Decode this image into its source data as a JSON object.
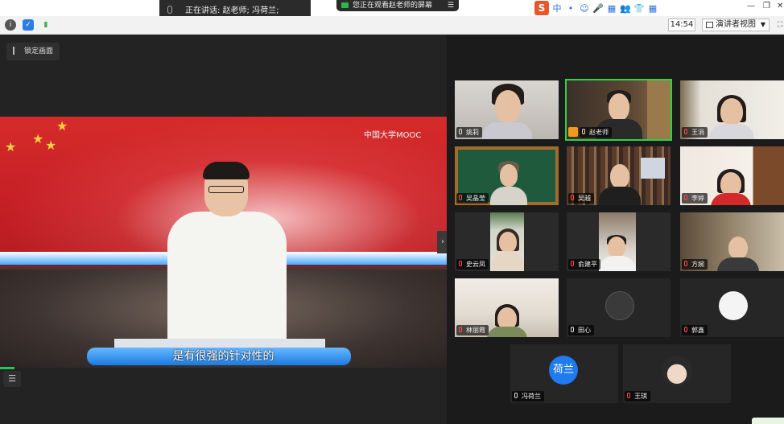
{
  "top": {
    "speaking_label": "正在讲话: 赵老师; 冯荷兰;",
    "watching_label": "您正在观看赵老师的屏幕",
    "time": "14:54",
    "view_mode": "演讲者视图",
    "ime_chars": [
      "中",
      "•",
      "☺",
      "🎤",
      "▦",
      "👥",
      "👕",
      "▦"
    ]
  },
  "main": {
    "lock_label": "锁定画面",
    "logo_text": "中国大学MOOC",
    "subtitle": "是有很强的针对性的"
  },
  "participants": [
    {
      "name": "姚莉",
      "scene": "light-room"
    },
    {
      "name": "赵老师",
      "scene": "bookshelf",
      "active": true,
      "host": true
    },
    {
      "name": "王涓",
      "scene": "bright-wall"
    },
    {
      "name": "吴晶莹",
      "scene": "chalkboard"
    },
    {
      "name": "吴越",
      "scene": "library"
    },
    {
      "name": "李婷",
      "scene": "home-door"
    },
    {
      "name": "史云凤",
      "scene": "window-plant"
    },
    {
      "name": "俞建平",
      "scene": "office"
    },
    {
      "name": "方婉",
      "scene": "study"
    },
    {
      "name": "林丽霞",
      "scene": "ceiling"
    },
    {
      "name": "田心",
      "scene": "avatar-dark"
    },
    {
      "name": "郭鑫",
      "scene": "avatar-light"
    },
    {
      "name": "冯荷兰",
      "scene": "avatar-text",
      "avatar_text": "荷兰"
    },
    {
      "name": "王琪",
      "scene": "avatar-cartoon"
    }
  ],
  "colors": {
    "active_border": "#2fd14a",
    "avatar_blue": "#1f7bef",
    "host_badge": "#f39a1e"
  }
}
